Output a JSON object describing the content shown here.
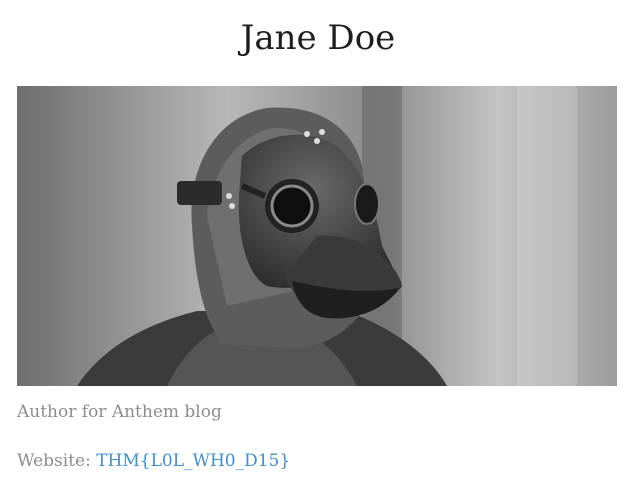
{
  "profile": {
    "name": "Jane Doe",
    "photo_alt": "Person wearing a plague doctor mask",
    "bio": "Author for Anthem blog",
    "website_label": "Website:",
    "website_value": "THM{L0L_WH0_D15}"
  }
}
